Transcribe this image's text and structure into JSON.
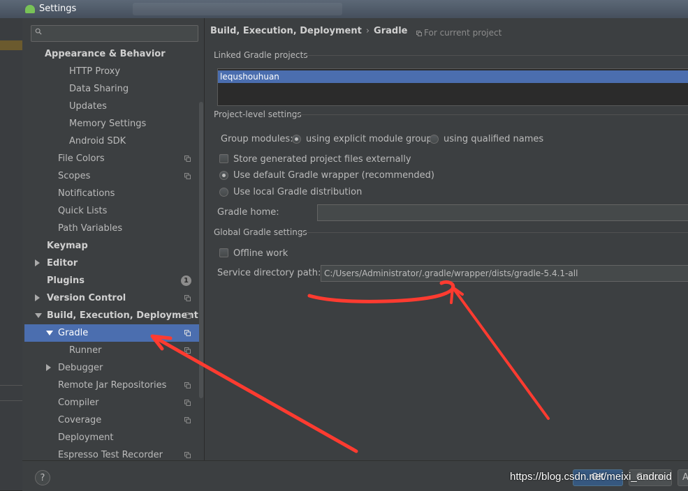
{
  "window": {
    "title": "Settings"
  },
  "search": {
    "placeholder": ""
  },
  "sidebar": {
    "items": [
      {
        "label": "Appearance & Behavior",
        "bold": true
      },
      {
        "label": "HTTP Proxy"
      },
      {
        "label": "Data Sharing"
      },
      {
        "label": "Updates"
      },
      {
        "label": "Memory Settings"
      },
      {
        "label": "Android SDK"
      },
      {
        "label": "File Colors"
      },
      {
        "label": "Scopes"
      },
      {
        "label": "Notifications"
      },
      {
        "label": "Quick Lists"
      },
      {
        "label": "Path Variables"
      },
      {
        "label": "Keymap",
        "bold": true
      },
      {
        "label": "Editor",
        "bold": true
      },
      {
        "label": "Plugins",
        "bold": true,
        "badge": "1"
      },
      {
        "label": "Version Control",
        "bold": true
      },
      {
        "label": "Build, Execution, Deployment",
        "bold": true
      },
      {
        "label": "Gradle",
        "selected": true
      },
      {
        "label": "Runner"
      },
      {
        "label": "Debugger"
      },
      {
        "label": "Remote Jar Repositories"
      },
      {
        "label": "Compiler"
      },
      {
        "label": "Coverage"
      },
      {
        "label": "Deployment"
      },
      {
        "label": "Espresso Test Recorder"
      }
    ]
  },
  "header": {
    "breadcrumb_parent": "Build, Execution, Deployment",
    "breadcrumb_sep": "›",
    "breadcrumb_current": "Gradle",
    "for_current_project": "For current project"
  },
  "linked": {
    "title": "Linked Gradle projects",
    "projects": [
      "lequshouhuan"
    ]
  },
  "project_level": {
    "title": "Project-level settings",
    "group_modules_label": "Group modules:",
    "explicit_groups": "using explicit module groups",
    "qualified_names": "using qualified names",
    "store_generated": "Store generated project files externally",
    "default_wrapper": "Use default Gradle wrapper (recommended)",
    "local_distribution": "Use local Gradle distribution",
    "gradle_home_label": "Gradle home:",
    "gradle_home_value": ""
  },
  "global": {
    "title": "Global Gradle settings",
    "offline_work": "Offline work",
    "service_dir_label": "Service directory path:",
    "service_dir_value": "C:/Users/Administrator/.gradle/wrapper/dists/gradle-5.4.1-all"
  },
  "buttons": {
    "help": "?",
    "ok": "OK",
    "cancel": "Cance",
    "apply": "A"
  },
  "watermark": "https://blog.csdn.net/meixi_android",
  "colors": {
    "selection": "#4b6eaf",
    "annotation": "#ff3b30"
  }
}
